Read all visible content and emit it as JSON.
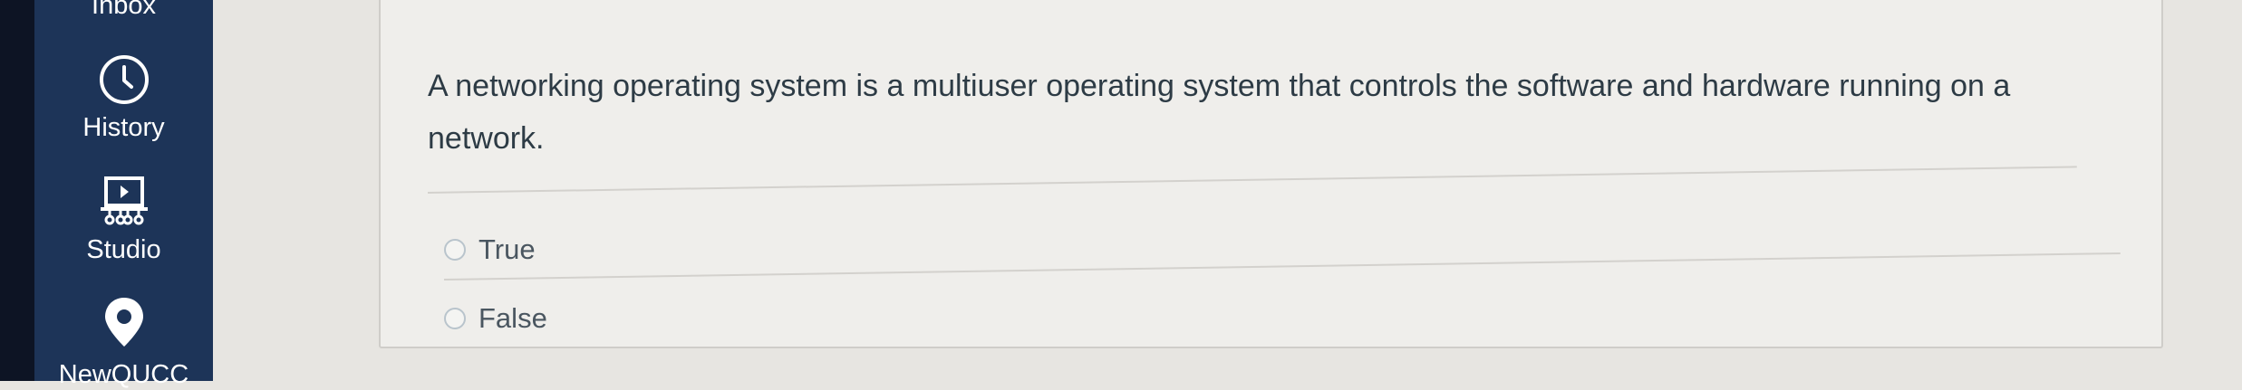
{
  "sidebar": {
    "items": [
      {
        "label": "Inbox",
        "icon": "inbox-icon"
      },
      {
        "label": "History",
        "icon": "clock-icon"
      },
      {
        "label": "Studio",
        "icon": "studio-icon"
      },
      {
        "label": "NewQUCC",
        "icon": "location-pin-icon"
      }
    ]
  },
  "question": {
    "text": "A networking operating system is a multiuser operating system that controls the software and hardware running on a network.",
    "answers": [
      {
        "label": "True"
      },
      {
        "label": "False"
      }
    ]
  },
  "colors": {
    "sidebar": "#1d3458",
    "sidebar_strip": "#0d1424",
    "page_background": "#e7e5e1",
    "question_text": "#2d3b45"
  }
}
